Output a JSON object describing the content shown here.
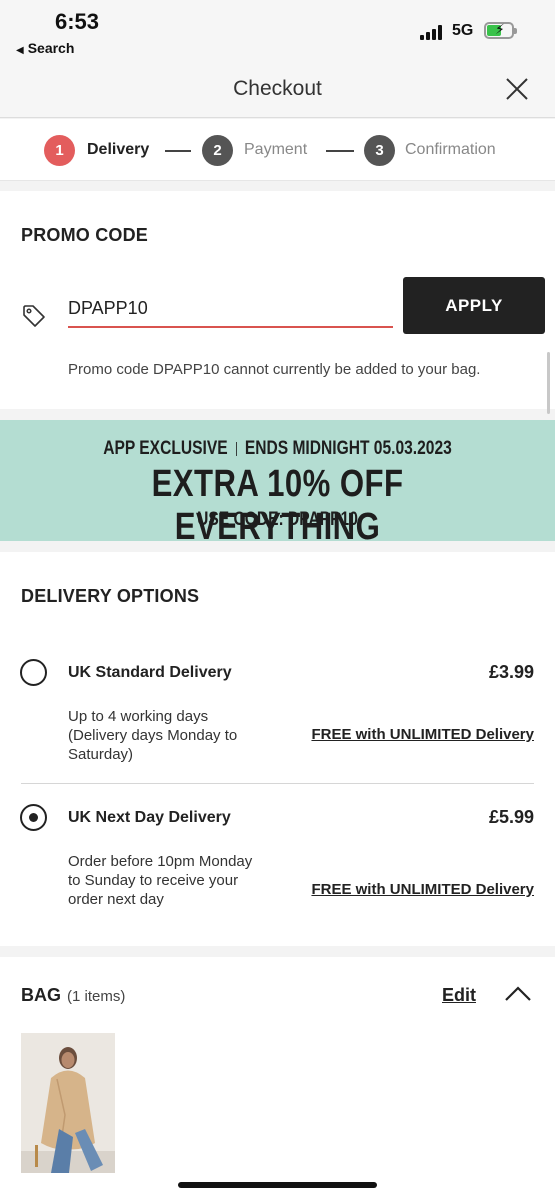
{
  "status_bar": {
    "time": "6:53",
    "back_label": "Search",
    "network": "5G"
  },
  "header": {
    "title": "Checkout"
  },
  "steps": [
    {
      "number": "1",
      "label": "Delivery",
      "active": true
    },
    {
      "number": "2",
      "label": "Payment",
      "active": false
    },
    {
      "number": "3",
      "label": "Confirmation",
      "active": false
    }
  ],
  "promo": {
    "title": "PROMO CODE",
    "input_value": "DPAPP10",
    "apply_label": "APPLY",
    "error": "Promo code DPAPP10 cannot currently be added to your bag."
  },
  "banner": {
    "left": "APP EXCLUSIVE",
    "right": "ENDS MIDNIGHT 05.03.2023",
    "main": "EXTRA 10% OFF EVERYTHING",
    "code": "USE CODE: DPAPP10",
    "color": "#b4ddd2"
  },
  "delivery": {
    "title": "DELIVERY OPTIONS",
    "options": [
      {
        "name": "UK Standard Delivery",
        "price": "£3.99",
        "description": "Up to 4 working days (Delivery days Monday to Saturday)",
        "free_note": "FREE with UNLIMITED Delivery",
        "selected": false
      },
      {
        "name": "UK Next Day Delivery",
        "price": "£5.99",
        "description": "Order before 10pm Monday to Sunday to receive your order next day",
        "free_note": "FREE with UNLIMITED Delivery",
        "selected": true
      }
    ]
  },
  "bag": {
    "title": "BAG",
    "count": "(1 items)",
    "edit_label": "Edit"
  },
  "colors": {
    "accent_step": "#e35d5d",
    "inactive_step": "#555555",
    "error_underline": "#d9534f"
  }
}
